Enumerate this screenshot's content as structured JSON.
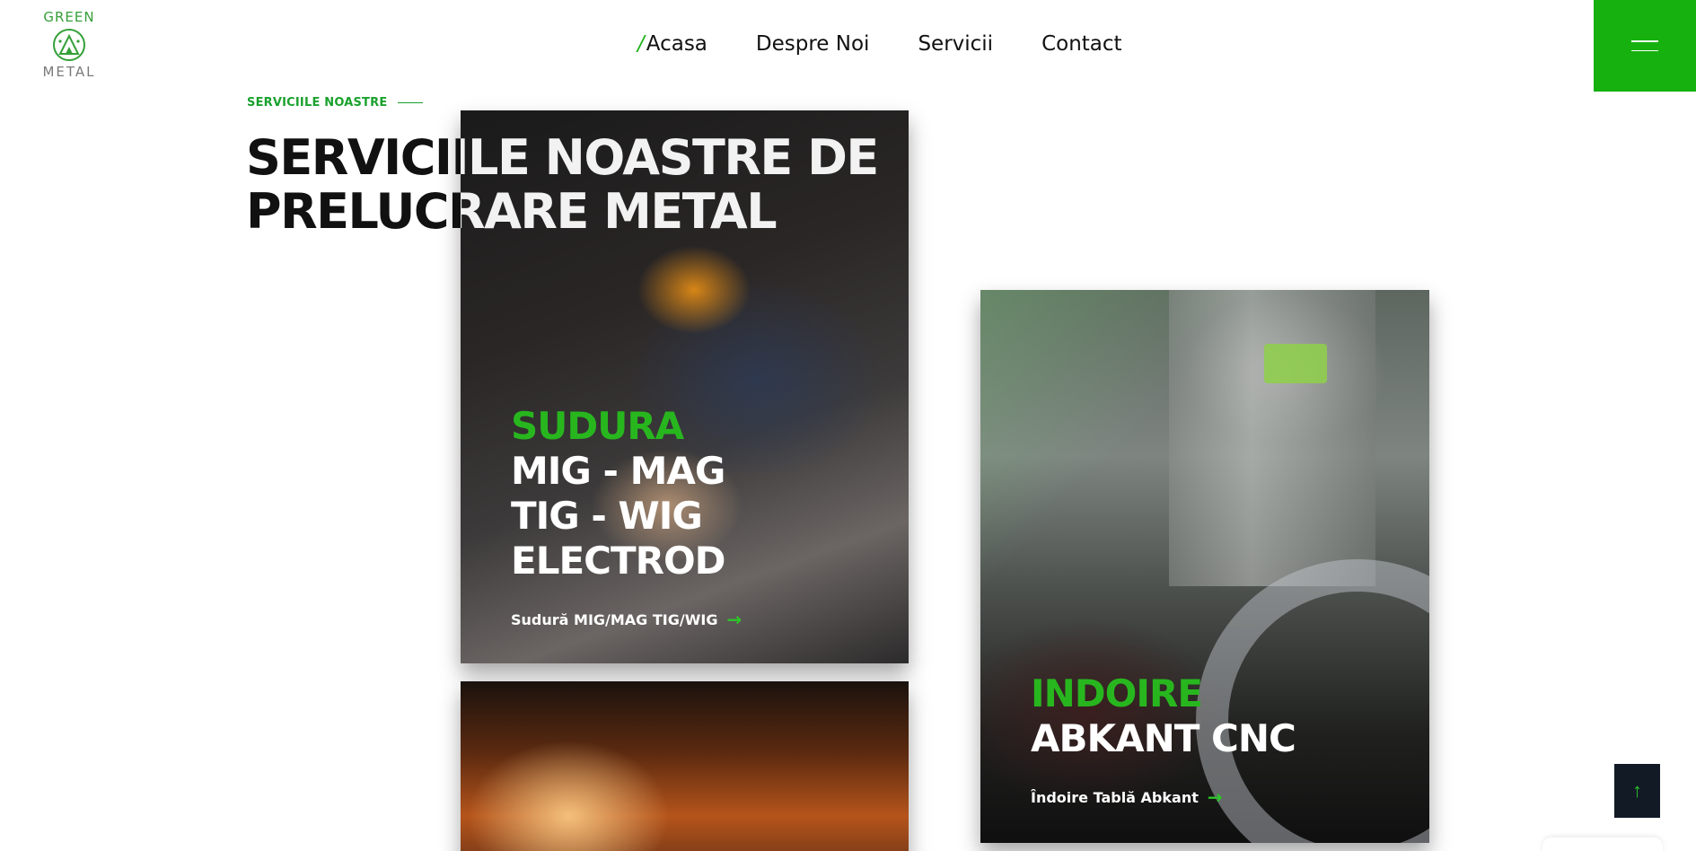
{
  "header": {
    "logo": {
      "line1": "GREEN",
      "line2": "METAL"
    },
    "nav": [
      {
        "label": "Acasa",
        "active": true
      },
      {
        "label": "Despre Noi"
      },
      {
        "label": "Servicii"
      },
      {
        "label": "Contact"
      }
    ],
    "active_marker": "/",
    "menu_icon": "hamburger-icon"
  },
  "section": {
    "eyebrow": "SERVICIILE NOASTRE",
    "title_line1": "SERVICIILE NOASTRE DE",
    "title_line2": "PRELUCRARE METAL"
  },
  "cards": [
    {
      "green_title": "SUDURA",
      "lines": [
        "MIG - MAG",
        "TIG - WIG",
        "ELECTROD"
      ],
      "link": "Sudură MIG/MAG TIG/WIG",
      "arrow": "→"
    },
    {
      "green_title": "INDOIRE",
      "lines": [
        "ABKANT CNC"
      ],
      "link": "Îndoire Tablă Abkant",
      "arrow": "→"
    }
  ],
  "back_to_top": "↑",
  "colors": {
    "brand_green": "#16b10f",
    "accent_green": "#28b61f",
    "dark": "#121a26"
  }
}
